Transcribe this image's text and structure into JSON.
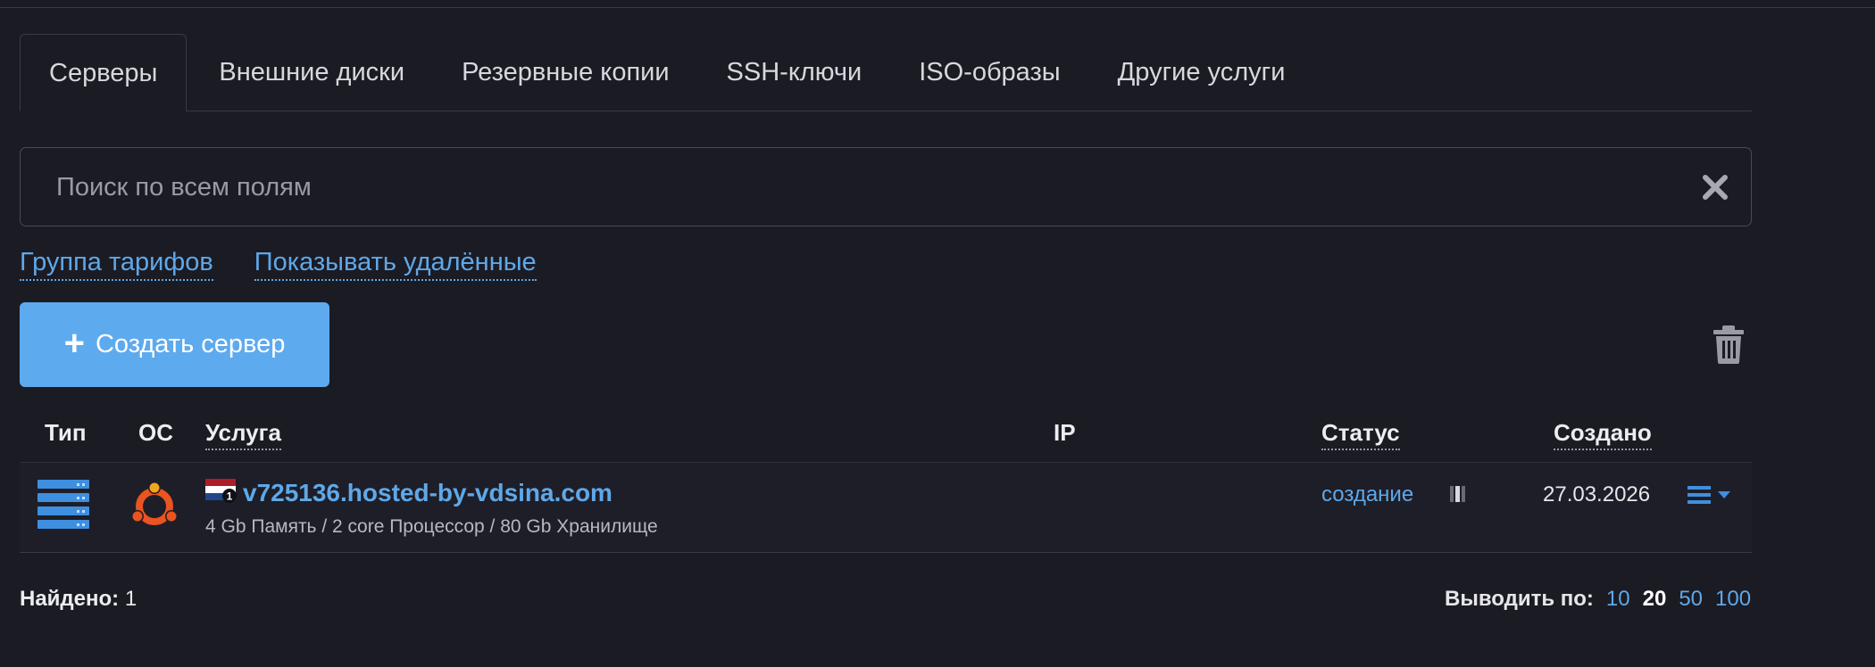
{
  "tabs": [
    {
      "label": "Серверы",
      "active": true
    },
    {
      "label": "Внешние диски"
    },
    {
      "label": "Резервные копии"
    },
    {
      "label": "SSH-ключи"
    },
    {
      "label": "ISO-образы"
    },
    {
      "label": "Другие услуги"
    }
  ],
  "search": {
    "placeholder": "Поиск по всем полям",
    "value": ""
  },
  "links": {
    "tariff_group": "Группа тарифов",
    "show_deleted": "Показывать удалённые"
  },
  "create_button": {
    "label": "Создать сервер"
  },
  "table": {
    "headers": {
      "type": "Тип",
      "os": "ОС",
      "service": "Услуга",
      "ip": "IP",
      "status": "Статус",
      "created": "Создано"
    },
    "rows": [
      {
        "type_icon": "server-rack-icon",
        "os_icon": "ubuntu-icon",
        "flag_icon": "netherlands-flag-icon",
        "flag_badge": "1",
        "name": "v725136.hosted-by-vdsina.com",
        "description": "4 Gb Память / 2 core Процессор / 80 Gb Хранилище",
        "ip": "",
        "status": "создание",
        "created": "27.03.2026"
      }
    ]
  },
  "footer": {
    "found_label": "Найдено:",
    "found_count": "1",
    "per_page_label": "Выводить по:",
    "per_page_options": [
      "10",
      "20",
      "50",
      "100"
    ],
    "per_page_selected": "20"
  },
  "colors": {
    "background": "#1b1b24",
    "accent": "#5fa8e8",
    "button": "#5eaaee",
    "ubuntu": "#e95420"
  }
}
